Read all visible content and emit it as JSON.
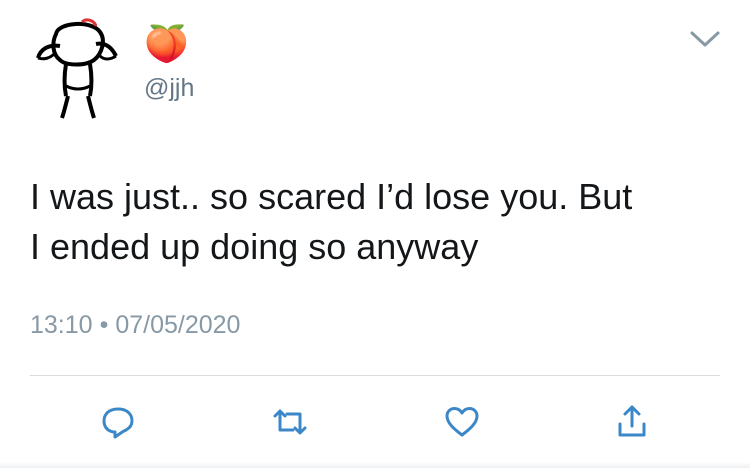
{
  "tweet": {
    "display_name": "🍑",
    "handle": "@jjh",
    "text": "I was just.. so scared I’d lose you. But\nI ended up doing so anyway",
    "time": "13:10",
    "separator": "•",
    "date": "07/05/2020"
  },
  "icons": {
    "avatar": "cartoon-figure-avatar",
    "menu": "chevron-down-icon",
    "reply": "reply-icon",
    "retweet": "retweet-icon",
    "like": "heart-icon",
    "share": "share-icon"
  },
  "colors": {
    "text": "#14171a",
    "secondary": "#657786",
    "meta": "#8899a6",
    "icon": "#3b87c8",
    "divider": "#d6dce0"
  }
}
